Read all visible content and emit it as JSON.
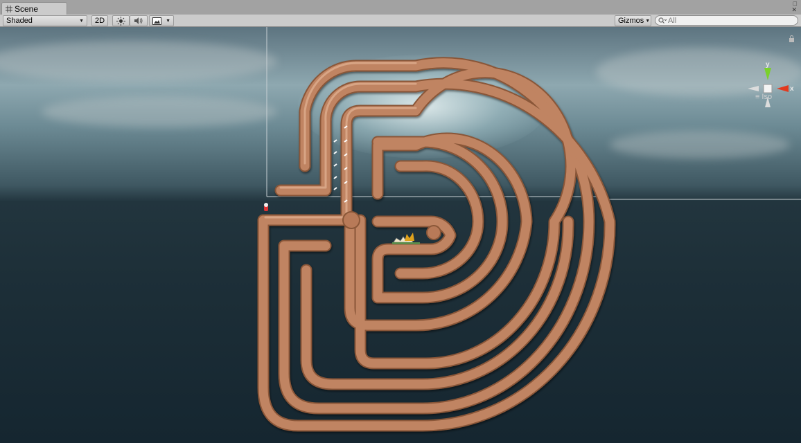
{
  "tab": {
    "title": "Scene",
    "icon": "scene-grid-icon"
  },
  "toolbar": {
    "draw_mode": "Shaded",
    "btn_2d": "2D",
    "gizmos_label": "Gizmos",
    "search_placeholder": "All"
  },
  "gizmo": {
    "y_label": "y",
    "x_label": "x",
    "projection": "Iso"
  },
  "colors": {
    "pipe": "#c08462",
    "axis_x": "#e23a1e",
    "axis_y": "#7ad12a"
  }
}
